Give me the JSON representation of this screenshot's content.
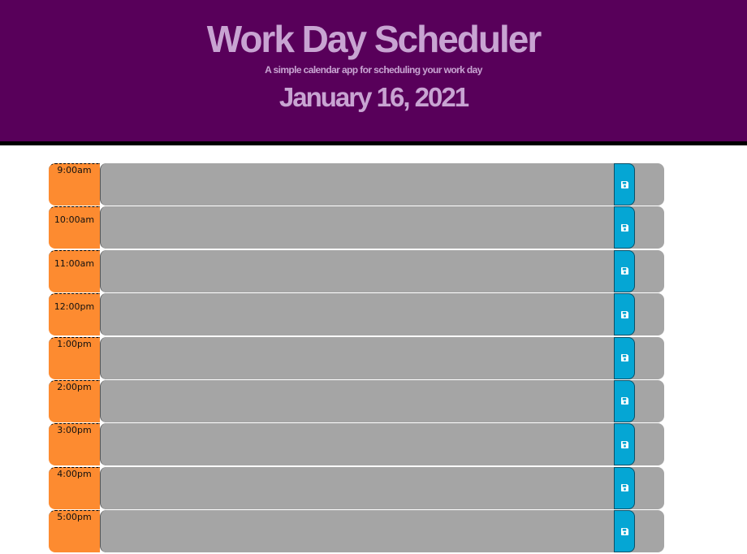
{
  "header": {
    "title": "Work Day Scheduler",
    "subtitle": "A simple calendar app for scheduling your work day",
    "date": "January 16, 2021"
  },
  "colors": {
    "header_bg": "#58005a",
    "title_text": "#c8a4d2",
    "hour_block": "#fd8b30",
    "past_textarea": "#a5a5a5",
    "save_button": "#05a6d4"
  },
  "timeblocks": [
    {
      "hour": "9:00am",
      "text": "",
      "save_icon": "floppy-disk-icon"
    },
    {
      "hour": "10:00am",
      "text": "",
      "save_icon": "floppy-disk-icon"
    },
    {
      "hour": "11:00am",
      "text": "",
      "save_icon": "floppy-disk-icon"
    },
    {
      "hour": "12:00pm",
      "text": "",
      "save_icon": "floppy-disk-icon"
    },
    {
      "hour": "1:00pm",
      "text": "",
      "save_icon": "floppy-disk-icon"
    },
    {
      "hour": "2:00pm",
      "text": "",
      "save_icon": "floppy-disk-icon"
    },
    {
      "hour": "3:00pm",
      "text": "",
      "save_icon": "floppy-disk-icon"
    },
    {
      "hour": "4:00pm",
      "text": "",
      "save_icon": "floppy-disk-icon"
    },
    {
      "hour": "5:00pm",
      "text": "",
      "save_icon": "floppy-disk-icon"
    }
  ]
}
